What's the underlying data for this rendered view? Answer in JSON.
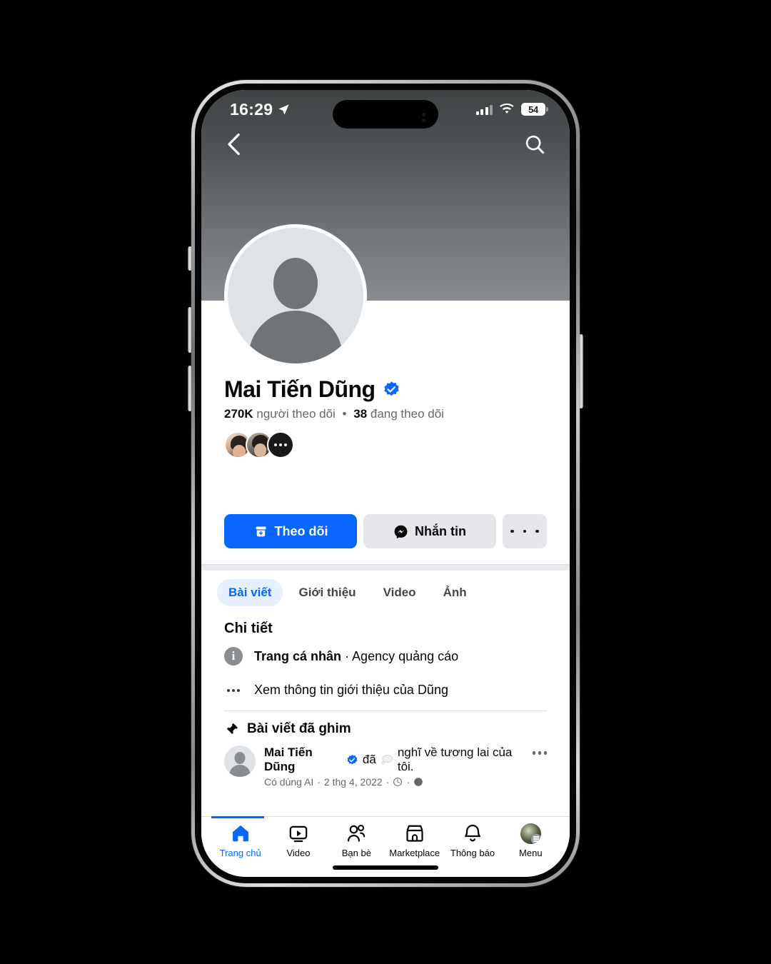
{
  "status_bar": {
    "time": "16:29",
    "location_icon": "location-arrow-icon",
    "signal_icon": "cellular-signal-icon",
    "wifi_icon": "wifi-icon",
    "battery_level": "54"
  },
  "cover": {
    "back_icon": "chevron-left-icon",
    "search_icon": "search-icon",
    "gradient_from": "#3f4344",
    "gradient_to": "#878c90"
  },
  "profile": {
    "avatar_icon": "default-avatar-icon",
    "name": "Mai Tiến Dũng",
    "verified_icon": "verified-badge-icon",
    "followers_count": "270K",
    "followers_label": "người theo dõi",
    "separator": "•",
    "following_count": "38",
    "following_label": "đang theo dõi",
    "mutual_more": "…"
  },
  "actions": {
    "follow_label": "Theo dõi",
    "follow_icon": "follow-person-icon",
    "message_label": "Nhắn tin",
    "message_icon": "messenger-icon",
    "more_icon": "ellipsis-icon"
  },
  "tabs": [
    {
      "label": "Bài viết",
      "active": true
    },
    {
      "label": "Giới thiệu",
      "active": false
    },
    {
      "label": "Video",
      "active": false
    },
    {
      "label": "Ảnh",
      "active": false
    }
  ],
  "details": {
    "title": "Chi tiết",
    "info_icon": "info-circle-icon",
    "category_bold": "Trang cá nhân",
    "category_sep": " · ",
    "category_rest": "Agency quảng cáo",
    "more_icon": "ellipsis-icon",
    "see_about": "Xem thông tin giới thiệu của Dũng"
  },
  "pinned": {
    "pin_icon": "pin-icon",
    "heading": "Bài viết đã ghim",
    "author": "Mai Tiến Dũng",
    "author_verified_icon": "verified-badge-icon",
    "action_word": "đã",
    "thought_icon": "thought-bubble-icon",
    "text": "nghĩ về tương lai của tôi.",
    "meta_ai": "Có dùng AI",
    "meta_sep": "·",
    "meta_date": "2 thg 4, 2022",
    "meta_clock_icon": "clock-icon",
    "meta_globe_icon": "globe-icon",
    "post_menu_icon": "ellipsis-icon"
  },
  "bottom_nav": [
    {
      "label": "Trang chủ",
      "icon": "home-icon",
      "active": true
    },
    {
      "label": "Video",
      "icon": "video-icon",
      "active": false
    },
    {
      "label": "Bạn bè",
      "icon": "friends-icon",
      "active": false
    },
    {
      "label": "Marketplace",
      "icon": "marketplace-icon",
      "active": false
    },
    {
      "label": "Thông báo",
      "icon": "bell-icon",
      "active": false
    },
    {
      "label": "Menu",
      "icon": "menu-avatar-icon",
      "active": false
    }
  ],
  "colors": {
    "brand_blue": "#0866ff",
    "tab_pill": "#e7f0fe",
    "gray_button": "#e4e6e9",
    "secondary_text": "#65676b"
  }
}
